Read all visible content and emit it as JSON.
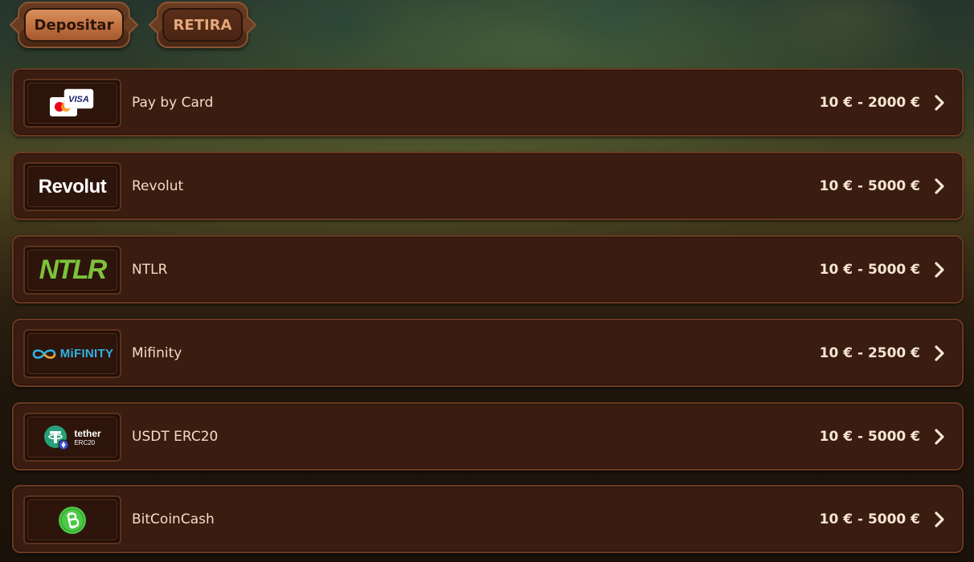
{
  "tabs": {
    "deposit_label": "Depositar",
    "withdraw_label": "RETIRA"
  },
  "methods": [
    {
      "name": "Pay by Card",
      "range": "10 € - 2000 €",
      "logo": "visa-mastercard-icon",
      "visa_text": "VISA"
    },
    {
      "name": "Revolut",
      "range": "10 € - 5000 €",
      "logo": "revolut-logo",
      "logo_text": "Revolut"
    },
    {
      "name": "NTLR",
      "range": "10 € - 5000 €",
      "logo": "ntlr-logo",
      "logo_text": "NTLR"
    },
    {
      "name": "Mifinity",
      "range": "10 € - 2500 €",
      "logo": "mifinity-logo",
      "logo_text": "MiFINITY"
    },
    {
      "name": "USDT ERC20",
      "range": "10 € - 5000 €",
      "logo": "tether-logo",
      "logo_text": "tether",
      "logo_sub": "ERC20"
    },
    {
      "name": "BitCoinCash",
      "range": "10 € - 5000 €",
      "logo": "bitcoin-cash-icon"
    }
  ],
  "colors": {
    "deposit_tab_bg": "#c07040",
    "withdraw_tab_text": "#e5a679",
    "row_bg": "#3a1c10",
    "row_border": "#6a3a22",
    "ntlr_green": "#7cc33b",
    "mifinity_blue": "#2fb2e4",
    "tether_teal": "#26a17b",
    "bch_green": "#4cc947"
  }
}
